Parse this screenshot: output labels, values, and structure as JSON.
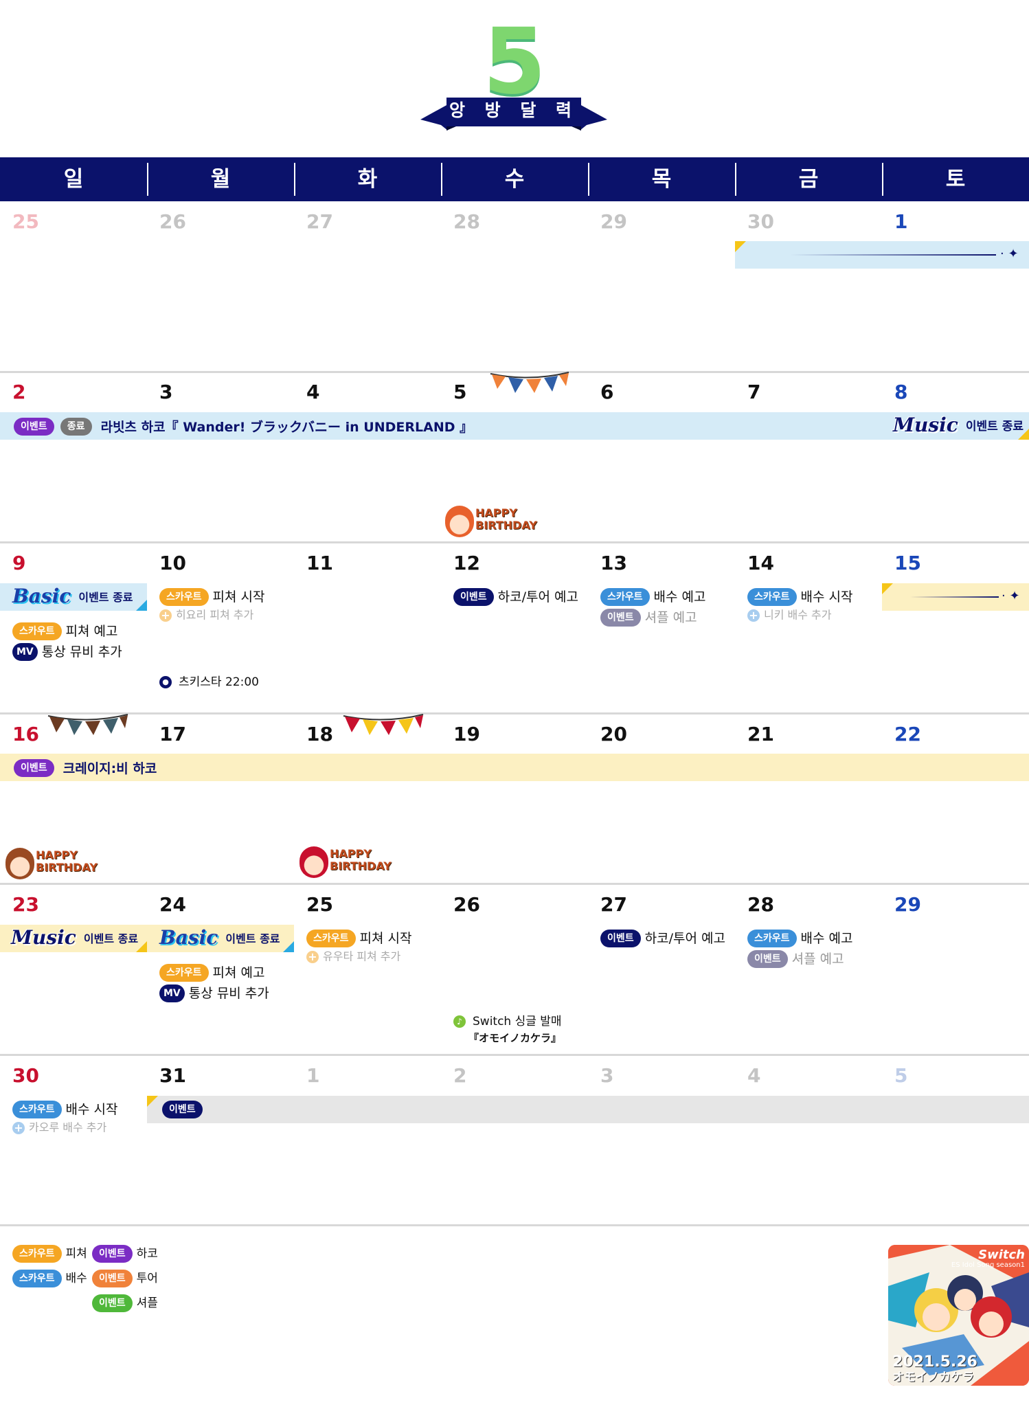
{
  "header": {
    "month": "5",
    "title": "앙 방 달 력"
  },
  "weekdays": [
    "일",
    "월",
    "화",
    "수",
    "목",
    "금",
    "토"
  ],
  "weeks": [
    [
      "25",
      "26",
      "27",
      "28",
      "29",
      "30",
      "1"
    ],
    [
      "2",
      "3",
      "4",
      "5",
      "6",
      "7",
      "8"
    ],
    [
      "9",
      "10",
      "11",
      "12",
      "13",
      "14",
      "15"
    ],
    [
      "16",
      "17",
      "18",
      "19",
      "20",
      "21",
      "22"
    ],
    [
      "23",
      "24",
      "25",
      "26",
      "27",
      "28",
      "29"
    ],
    [
      "30",
      "31",
      "1",
      "2",
      "3",
      "4",
      "5"
    ]
  ],
  "badges": {
    "scout": "스카우트",
    "event": "이벤트",
    "end": "종료",
    "mv": "MV"
  },
  "logos": {
    "music": "Music",
    "basic": "Basic"
  },
  "events": {
    "hako_end_badge_label": "이벤트",
    "hako_title": "라빗츠 하코『 Wander! ブラックバニー in UNDERLAND 』",
    "music_end": "이벤트 종료",
    "basic_end": "이벤트 종료",
    "w3_sun_pitch": "피쳐 예고",
    "w3_sun_mv": "통상 뮤비 추가",
    "w3_mon_pitch_start": "피쳐 시작",
    "w3_mon_sub": "히요리 피쳐 추가",
    "w3_mon_radio": "츠키스타 22:00",
    "w3_wed": "하코/투어 예고",
    "w3_thu_bae": "배수 예고",
    "w3_thu_shuffle": "셔플 예고",
    "w3_fri_bae": "배수 시작",
    "w3_fri_sub": "니키 배수 추가",
    "w4_event": "크레이지:비 하코",
    "w5_mon_pitch": "피쳐 예고",
    "w5_mon_mv": "통상 뮤비 추가",
    "w5_tue_pitch": "피쳐 시작",
    "w5_tue_sub": "유우타 피쳐 추가",
    "w5_wed_release_1": "Switch 싱글 발매",
    "w5_wed_release_2": "『オモイノカケラ』",
    "w5_thu": "하코/투어 예고",
    "w5_fri_bae": "배수 예고",
    "w5_fri_shuffle": "셔플 예고",
    "w6_sun_bae": "배수 시작",
    "w6_sun_sub": "카오루 배수 추가"
  },
  "birthday": {
    "line1": "HAPPY",
    "line2": "BIRTHDAY"
  },
  "legend": [
    {
      "badge": "스카우트",
      "label": "피쳐",
      "color": "#f5a623"
    },
    {
      "badge": "스카우트",
      "label": "배수",
      "color": "#3a8fd9"
    },
    {
      "badge": "이벤트",
      "label": "하코",
      "color": "#7b2cc4"
    },
    {
      "badge": "이벤트",
      "label": "투어",
      "color": "#f0823a"
    },
    {
      "badge": "이벤트",
      "label": "셔플",
      "color": "#4fb83a"
    }
  ],
  "album": {
    "brand": "Switch",
    "series": "ES Idol Song season1",
    "date": "2021.5.26",
    "title": "オモイノカケラ"
  },
  "colors": {
    "navy": "#0b126b",
    "sunday": "#c8102e",
    "saturday": "#1a47b8",
    "bar_blue": "#d5ebf7",
    "bar_yellow": "#fcf0c2",
    "bar_gray": "#e6e6e6"
  }
}
